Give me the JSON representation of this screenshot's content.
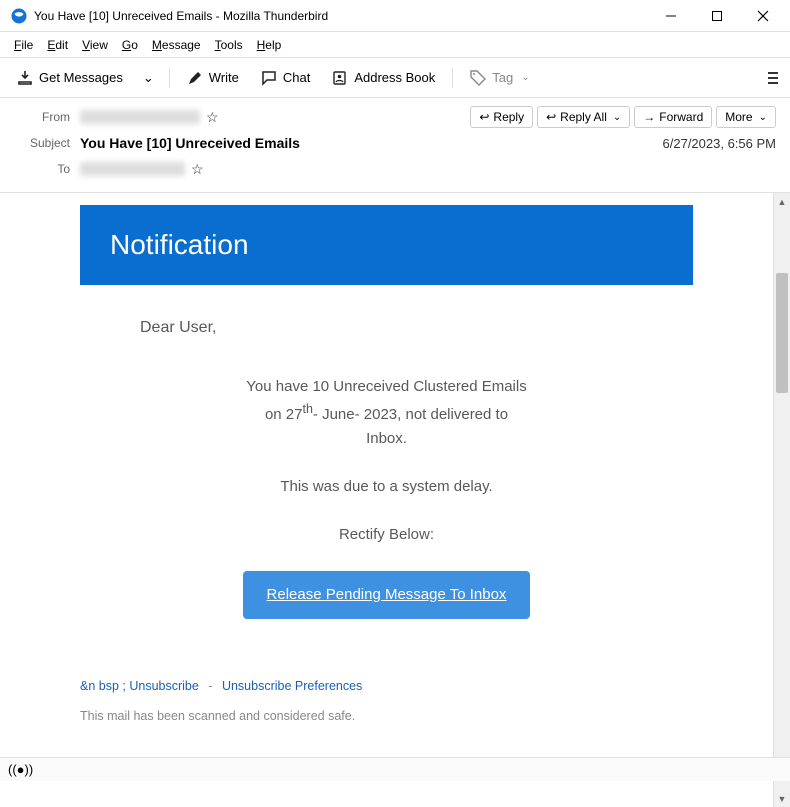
{
  "window": {
    "title": "You Have [10] Unreceived Emails - Mozilla Thunderbird"
  },
  "menu": {
    "file": "File",
    "file_u": "F",
    "edit": "Edit",
    "edit_u": "E",
    "view": "View",
    "view_u": "V",
    "go": "Go",
    "go_u": "G",
    "message": "Message",
    "message_u": "M",
    "tools": "Tools",
    "tools_u": "T",
    "help": "Help",
    "help_u": "H"
  },
  "toolbar": {
    "get_messages": "Get Messages",
    "write": "Write",
    "chat": "Chat",
    "address_book": "Address Book",
    "tag": "Tag"
  },
  "header": {
    "from_label": "From",
    "subject_label": "Subject",
    "to_label": "To",
    "subject": "You Have [10] Unreceived Emails",
    "date": "6/27/2023, 6:56 PM",
    "reply": "Reply",
    "reply_all": "Reply All",
    "forward": "Forward",
    "more": "More"
  },
  "email": {
    "banner": "Notification",
    "greeting": "Dear User,",
    "line1": "You have 10 Unreceived Clustered Emails",
    "line2a": "on 27",
    "line2sup": "th",
    "line2b": "- June- 2023, not delivered to",
    "line3": "Inbox.",
    "delay": "This was due to a system delay.",
    "rectify": "Rectify Below:",
    "cta": "Release Pending Message To Inbox",
    "unsub1": "&n bsp ; Unsubscribe",
    "unsub_sep": "-",
    "unsub2": "Unsubscribe Preferences",
    "safe": "This mail has been scanned and considered safe."
  }
}
